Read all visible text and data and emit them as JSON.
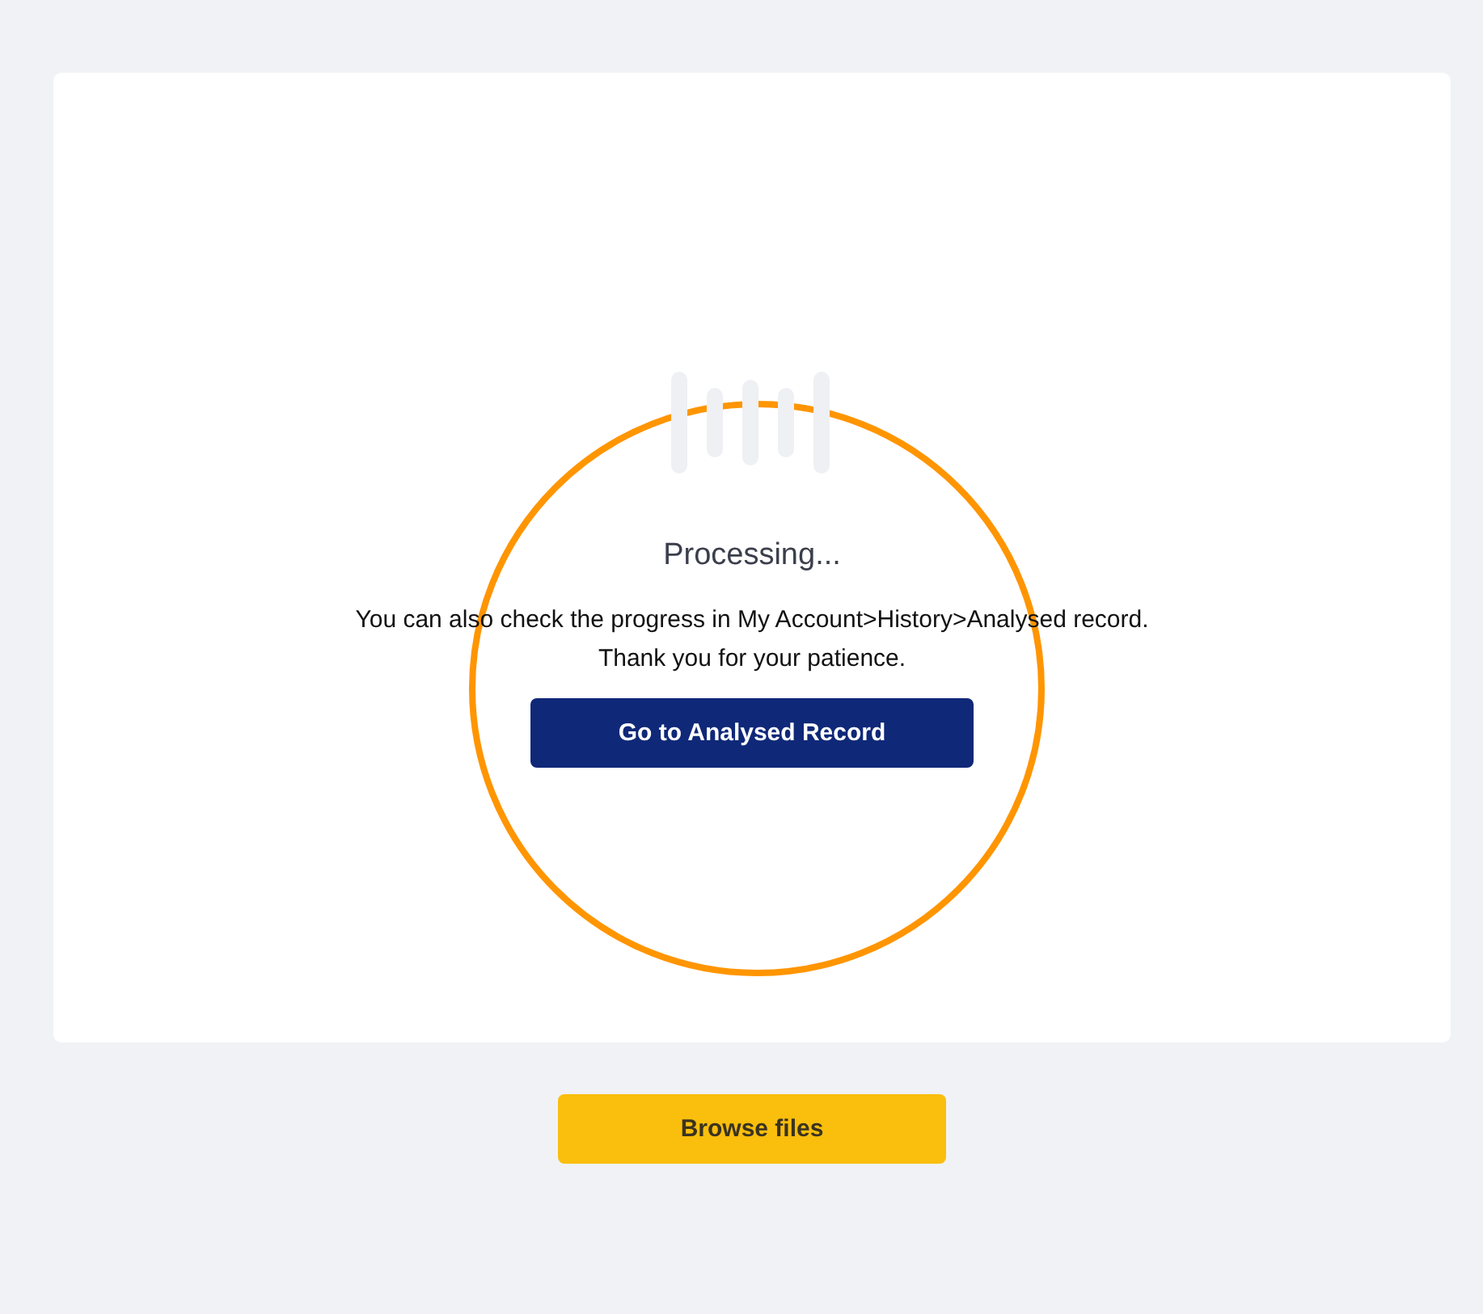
{
  "status": {
    "title": "Processing...",
    "lines": [
      "You can also check the progress in My Account>History>Analysed record.",
      "Thank you for your patience."
    ],
    "button": "Go to Analysed Record"
  },
  "browse_button": "Browse files"
}
